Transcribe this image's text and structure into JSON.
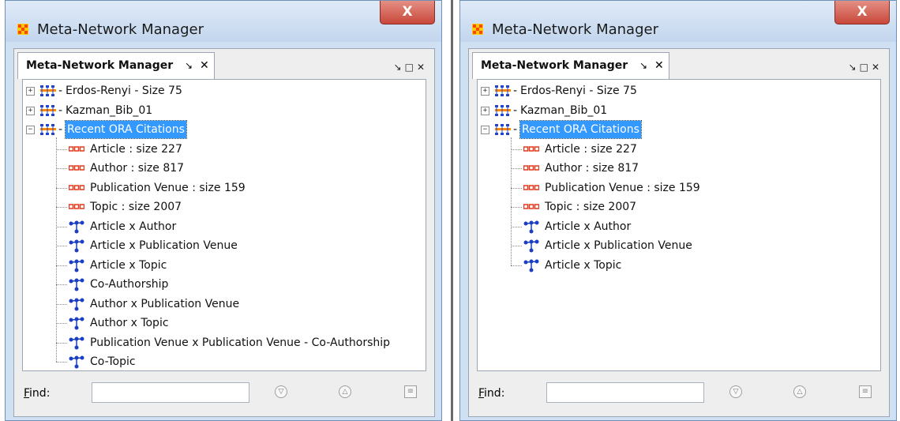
{
  "window_title": "Meta-Network Manager",
  "close_glyph": "X",
  "panel": {
    "tab_label": "Meta-Network Manager",
    "tab_pin": "↘",
    "tab_close": "✕",
    "controls": "↘□✕"
  },
  "networks": [
    {
      "label": "Erdos-Renyi - Size 75",
      "expanded": false
    },
    {
      "label": "Kazman_Bib_01",
      "expanded": false
    },
    {
      "label": "Recent ORA Citations",
      "expanded": true,
      "selected": true
    }
  ],
  "left_children": [
    {
      "kind": "nodeset",
      "label": "Article : size 227"
    },
    {
      "kind": "nodeset",
      "label": "Author : size 817"
    },
    {
      "kind": "nodeset",
      "label": "Publication Venue : size 159"
    },
    {
      "kind": "nodeset",
      "label": "Topic : size 2007"
    },
    {
      "kind": "network",
      "label": "Article x Author"
    },
    {
      "kind": "network",
      "label": "Article x Publication Venue"
    },
    {
      "kind": "network",
      "label": "Article x Topic"
    },
    {
      "kind": "network",
      "label": "Co-Authorship"
    },
    {
      "kind": "network",
      "label": "Author x Publication Venue"
    },
    {
      "kind": "network",
      "label": "Author x Topic"
    },
    {
      "kind": "network",
      "label": "Publication Venue x Publication Venue - Co-Authorship"
    },
    {
      "kind": "network",
      "label": "Co-Topic"
    }
  ],
  "right_children": [
    {
      "kind": "nodeset",
      "label": "Article : size 227"
    },
    {
      "kind": "nodeset",
      "label": "Author : size 817"
    },
    {
      "kind": "nodeset",
      "label": "Publication Venue : size 159"
    },
    {
      "kind": "nodeset",
      "label": "Topic : size 2007"
    },
    {
      "kind": "network",
      "label": "Article x Author"
    },
    {
      "kind": "network",
      "label": "Article x Publication Venue"
    },
    {
      "kind": "network",
      "label": "Article x Topic"
    }
  ],
  "find": {
    "label_first": "F",
    "label_rest": "ind:",
    "value": "",
    "down_glyph": "▽",
    "up_glyph": "△",
    "list_glyph": "≡"
  },
  "colors": {
    "selection": "#3399ff",
    "meta_icon_blue": "#2244cc",
    "meta_icon_orange": "#ff8800",
    "nodeset_red": "#e53a1e",
    "close_red": "#c8473a"
  }
}
